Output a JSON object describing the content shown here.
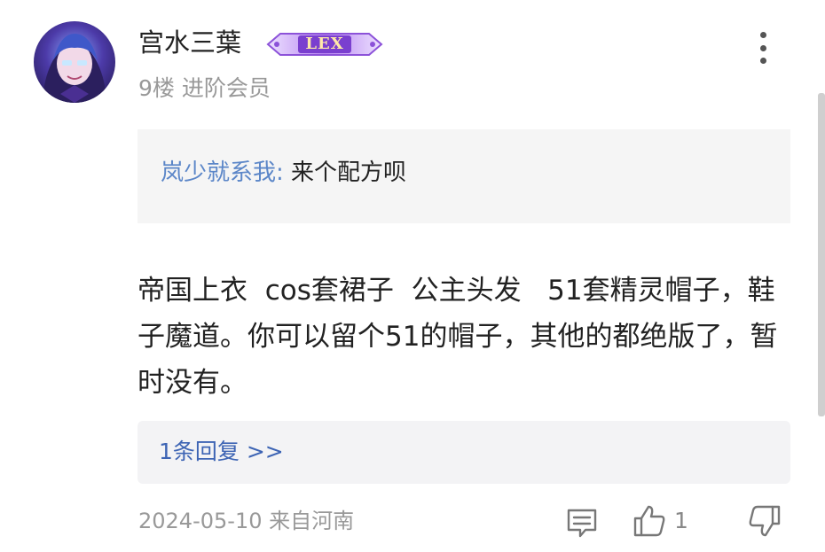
{
  "post": {
    "username": "宫水三葉",
    "badge_text": "LEX",
    "floor": "9楼",
    "member_level": "进阶会员",
    "quote": {
      "author": "岚少就系我:",
      "text": "来个配方呗"
    },
    "content": "帝国上衣  cos套裙子  公主头发   51套精灵帽子，鞋子魔道。你可以留个51的帽子，其他的都绝版了，暂时没有。",
    "replies_link": "1条回复 >>",
    "date_location": "2024-05-10 来自河南",
    "like_count": "1"
  },
  "colors": {
    "quote_author": "#5b86c8",
    "reply_link": "#3d64b4",
    "badge_purple": "#8c52d9"
  },
  "icons": {
    "more": "more-vertical-icon",
    "comment": "comment-icon",
    "like": "thumbs-up-icon",
    "dislike": "thumbs-down-icon"
  }
}
